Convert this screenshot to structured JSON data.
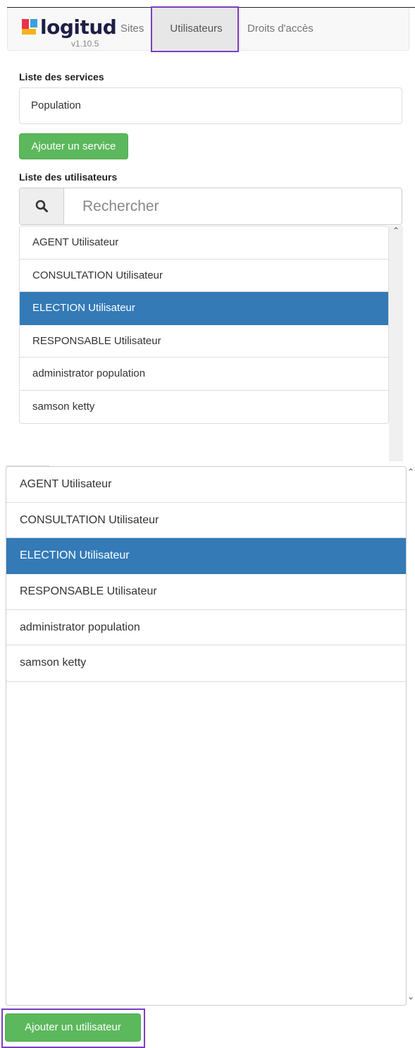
{
  "app": {
    "logo_text": "logitud",
    "version": "v1.10.5",
    "logo_colors": {
      "red": "#e8344e",
      "blue": "#3aa0dc",
      "yellow": "#f6b21a",
      "dark": "#1e1e46"
    }
  },
  "nav": {
    "tabs": [
      {
        "label": "Sites"
      },
      {
        "label": "Utilisateurs",
        "active": true
      },
      {
        "label": "Droits d'accès"
      }
    ]
  },
  "services": {
    "title": "Liste des services",
    "items": [
      "Population"
    ],
    "add_button": "Ajouter un service"
  },
  "users": {
    "title": "Liste des utilisateurs",
    "search_placeholder": "Rechercher",
    "items": [
      {
        "label": "AGENT Utilisateur"
      },
      {
        "label": "CONSULTATION Utilisateur"
      },
      {
        "label": "ELECTION Utilisateur",
        "selected": true
      },
      {
        "label": "RESPONSABLE Utilisateur"
      },
      {
        "label": "administrator population"
      },
      {
        "label": "samson ketty"
      }
    ],
    "add_button": "Ajouter un utilisateur"
  },
  "colors": {
    "selected": "#337ab7",
    "success": "#5cb85c",
    "highlight": "#7b3fbf"
  }
}
